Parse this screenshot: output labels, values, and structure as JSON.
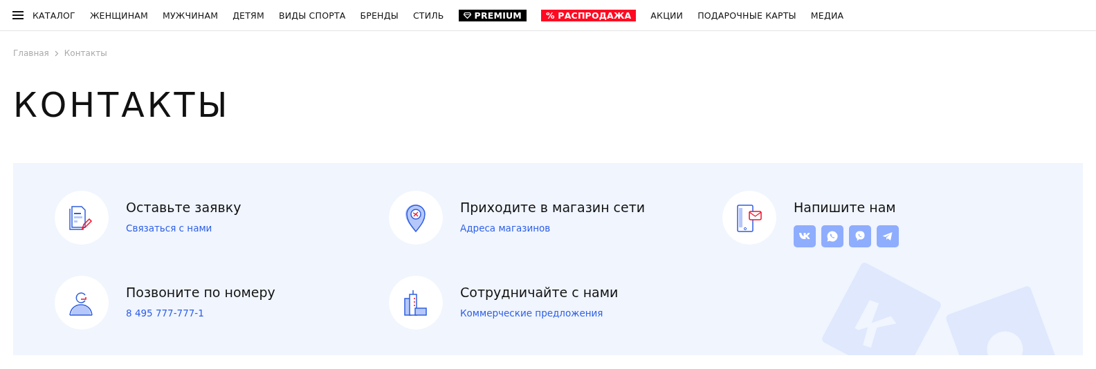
{
  "nav": {
    "items": [
      {
        "label": "КАТАЛОГ",
        "kind": "plain"
      },
      {
        "label": "ЖЕНЩИНАМ",
        "kind": "plain"
      },
      {
        "label": "МУЖЧИНАМ",
        "kind": "plain"
      },
      {
        "label": "ДЕТЯМ",
        "kind": "plain"
      },
      {
        "label": "ВИДЫ СПОРТА",
        "kind": "plain"
      },
      {
        "label": "БРЕНДЫ",
        "kind": "plain"
      },
      {
        "label": "СТИЛЬ",
        "kind": "plain"
      },
      {
        "label": "PREMIUM",
        "kind": "premium"
      },
      {
        "label": "% РАСПРОДАЖА",
        "kind": "sale"
      },
      {
        "label": "АКЦИИ",
        "kind": "plain"
      },
      {
        "label": "ПОДАРОЧНЫЕ КАРТЫ",
        "kind": "plain"
      },
      {
        "label": "МЕДИА",
        "kind": "plain"
      }
    ]
  },
  "breadcrumbs": [
    "Главная",
    "Контакты"
  ],
  "title": "КОНТАКТЫ",
  "cards": [
    {
      "kind": "request",
      "title": "Оставьте заявку",
      "link": "Связаться с нами"
    },
    {
      "kind": "store",
      "title": "Приходите в магазин сети",
      "link": "Адреса магазинов"
    },
    {
      "kind": "write",
      "title": "Напишите нам",
      "socials": [
        {
          "kind": "vk"
        },
        {
          "kind": "whatsapp"
        },
        {
          "kind": "viber"
        },
        {
          "kind": "telegram"
        }
      ]
    },
    {
      "kind": "call",
      "title": "Позвоните по номеру",
      "link": "8 495 777-777-1"
    },
    {
      "kind": "partner",
      "title": "Сотрудничайте с нами",
      "link": "Коммерческие предложения"
    }
  ]
}
